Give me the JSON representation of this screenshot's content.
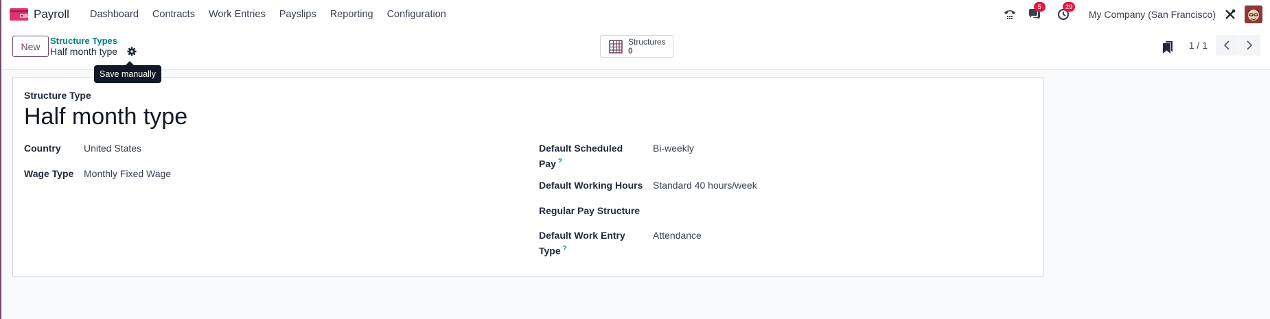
{
  "navbar": {
    "app_name": "Payroll",
    "menu": [
      "Dashboard",
      "Contracts",
      "Work Entries",
      "Payslips",
      "Reporting",
      "Configuration"
    ],
    "messages_badge": "5",
    "activities_badge": "29",
    "company": "My Company (San Francisco)"
  },
  "control_panel": {
    "new_label": "New",
    "breadcrumb_parent": "Structure Types",
    "breadcrumb_current": "Half month type",
    "tooltip": "Save manually",
    "smart_button": {
      "label": "Structures",
      "count": "0"
    },
    "pager": "1 / 1"
  },
  "form": {
    "header_label": "Structure Type",
    "title": "Half month type",
    "left_fields": [
      {
        "label": "Country",
        "value": "United States"
      },
      {
        "label": "Wage Type",
        "value": "Monthly Fixed Wage"
      }
    ],
    "right_fields": [
      {
        "label_line1": "Default Scheduled",
        "label_line2": "Pay",
        "help": "?",
        "value": "Bi-weekly"
      },
      {
        "label": "Default Working Hours",
        "value": "Standard 40 hours/week"
      },
      {
        "label": "Regular Pay Structure",
        "value": ""
      },
      {
        "label_line1": "Default Work Entry",
        "label_line2": "Type",
        "help": "?",
        "value": "Attendance"
      }
    ]
  },
  "colors": {
    "brand": "#714b67",
    "accent": "#017e84",
    "badge": "#e3173e"
  }
}
